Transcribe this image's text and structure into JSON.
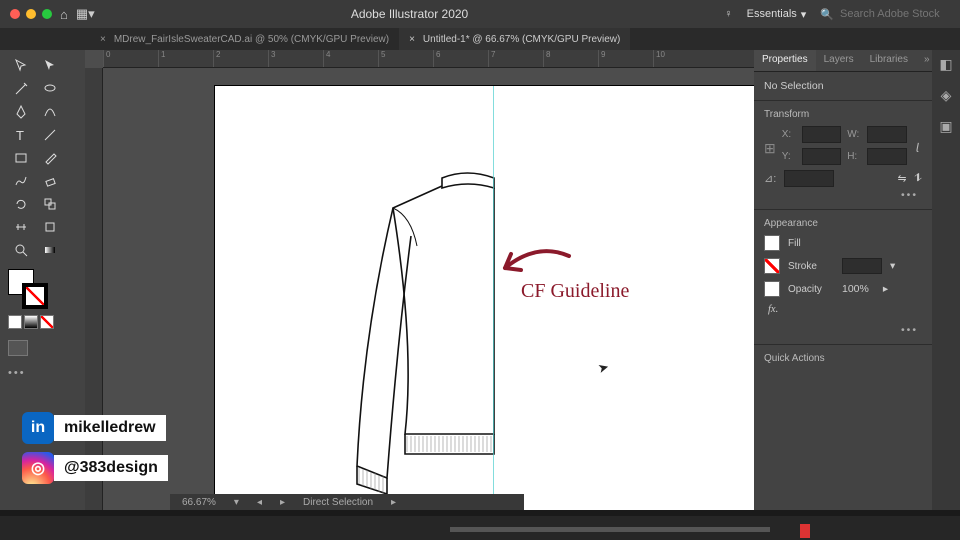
{
  "app_title": "Adobe Illustrator 2020",
  "workspace": "Essentials",
  "search": {
    "placeholder": "Search Adobe Stock"
  },
  "tabs": [
    {
      "label": "MDrew_FairIsleSweaterCAD.ai @ 50% (CMYK/GPU Preview)",
      "active": false
    },
    {
      "label": "Untitled-1* @ 66.67% (CMYK/GPU Preview)",
      "active": true
    }
  ],
  "ruler_marks": [
    "0",
    "1",
    "2",
    "3",
    "4",
    "5",
    "6",
    "7",
    "8",
    "9",
    "10"
  ],
  "annotation_text": "CF Guideline",
  "status": {
    "zoom": "66.67%",
    "tool": "Direct Selection"
  },
  "panel": {
    "tabs": [
      "Properties",
      "Layers",
      "Libraries"
    ],
    "selection_text": "No Selection",
    "transform_hdr": "Transform",
    "labels": {
      "x": "X:",
      "y": "Y:",
      "w": "W:",
      "h": "H:",
      "angle": "⊿:"
    },
    "appearance_hdr": "Appearance",
    "fill_label": "Fill",
    "stroke_label": "Stroke",
    "opacity_label": "Opacity",
    "opacity_value": "100%",
    "fx_label": "fx.",
    "quick_hdr": "Quick Actions"
  },
  "social": {
    "linkedin": "mikelledrew",
    "instagram": "@383design"
  }
}
